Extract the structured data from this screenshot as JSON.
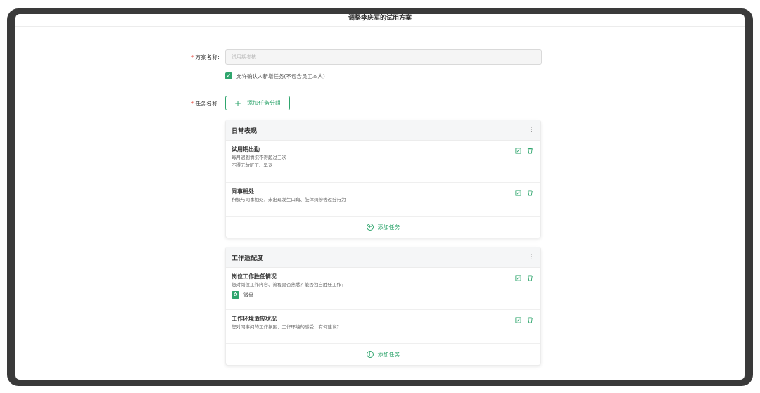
{
  "window": {
    "title": "调整李庆军的试用方案"
  },
  "form": {
    "plan_label": "方案名称:",
    "plan_placeholder": "试用期考核",
    "allow_checkbox_label": "允许确认人新增任务(不包含员工本人)",
    "task_label": "任务名称:",
    "add_group_button": "添加任务分组",
    "required_mark": "*"
  },
  "groups": [
    {
      "title": "日常表现",
      "tasks": [
        {
          "title": "试用期出勤",
          "desc_lines": [
            "每月迟到情况不得超过三次",
            "不得无故旷工、早退"
          ]
        },
        {
          "title": "同事相处",
          "desc_lines": [
            "积极与同事相处，未出现发生口角、肢体纠纷等过分行为"
          ]
        }
      ],
      "add_task_label": "添加任务"
    },
    {
      "title": "工作适配度",
      "tasks": [
        {
          "title": "岗位工作胜任情况",
          "desc_lines": [
            "您对岗位工作内容、流程是否熟悉？能否独自胜任工作？"
          ],
          "tag": "微盘"
        },
        {
          "title": "工作环境适应状况",
          "desc_lines": [
            "您对同事间的工作氛围、工作环境的感受，有何建议？"
          ]
        }
      ],
      "add_task_label": "添加任务"
    }
  ],
  "icons": {
    "check": "check-icon",
    "edit": "edit-icon",
    "delete": "trash-icon",
    "more": "more-vertical-icon",
    "tag": "leaf-icon",
    "add": "plus-circle-icon"
  },
  "colors": {
    "accent": "#2fa56d",
    "required": "#e2483d"
  }
}
